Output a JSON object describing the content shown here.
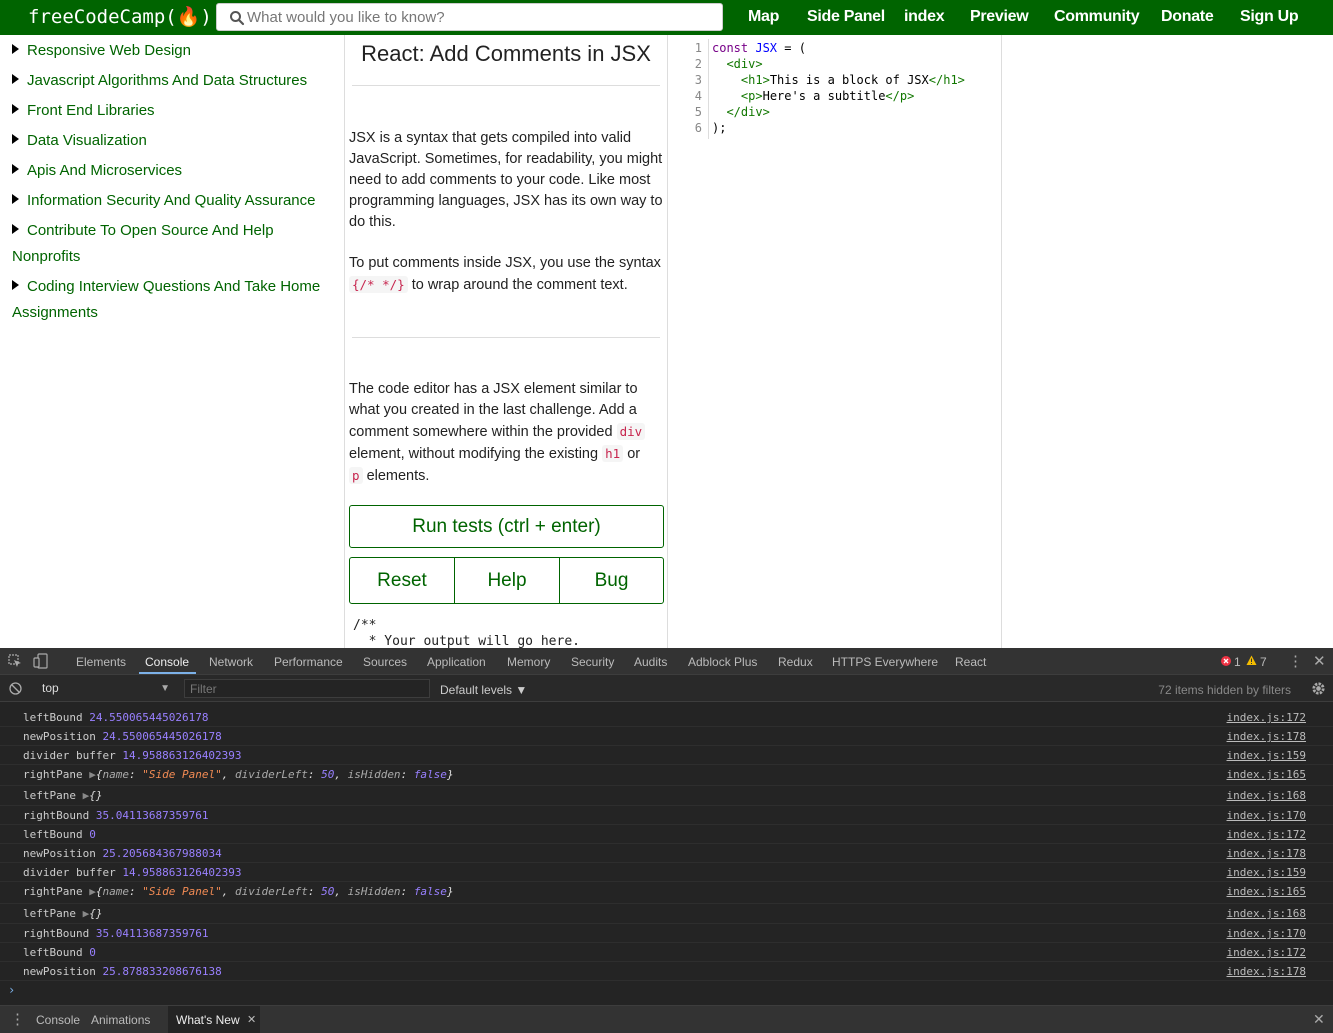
{
  "nav": {
    "logo": "freeCodeCamp(🔥)",
    "search_placeholder": "What would you like to know?",
    "links": [
      "Map",
      "Side Panel",
      "index",
      "Preview",
      "Community",
      "Donate",
      "Sign Up"
    ]
  },
  "map": {
    "items": [
      {
        "label": "Responsive Web Design"
      },
      {
        "label": "Javascript Algorithms And Data Structures"
      },
      {
        "label": "Front End Libraries"
      },
      {
        "label": "Data Visualization"
      },
      {
        "label": "Apis And Microservices"
      },
      {
        "label": "Information Security And Quality Assurance"
      },
      {
        "label": "Contribute To Open Source And Help Nonprofits"
      },
      {
        "label": "Coding Interview Questions And Take Home Assignments"
      }
    ]
  },
  "challenge": {
    "title": "React: Add Comments in JSX",
    "p1": "JSX is a syntax that gets compiled into valid JavaScript. Sometimes, for readability, you might need to add comments to your code. Like most programming languages, JSX has its own way to do this.",
    "p2_a": "To put comments inside JSX, you use the syntax",
    "p2_code": "{/* */}",
    "p2_b": "to wrap around the comment text.",
    "p3_a": "The code editor has a JSX element similar to what you created in the last challenge. Add a comment somewhere within the provided",
    "p3_code1": "div",
    "p3_b": "element, without modifying the existing",
    "p3_code2": "h1",
    "p3_c": "or",
    "p3_code3": "p",
    "p3_d": "elements.",
    "run_label": "Run tests (ctrl + enter)",
    "reset_label": "Reset",
    "help_label": "Help",
    "bug_label": "Bug",
    "output": "/**\n  * Your output will go here."
  },
  "editor": {
    "line_numbers": [
      "1",
      "2",
      "3",
      "4",
      "5",
      "6"
    ]
  },
  "devtools": {
    "tabs": [
      "Elements",
      "Console",
      "Network",
      "Performance",
      "Sources",
      "Application",
      "Memory",
      "Security",
      "Audits",
      "Adblock Plus",
      "Redux",
      "HTTPS Everywhere",
      "React"
    ],
    "errors": "1",
    "warnings": "7",
    "context": "top",
    "filter_placeholder": "Filter",
    "levels": "Default levels ▼",
    "hidden": "72 items hidden by filters",
    "logs": [
      {
        "label": "leftBound",
        "value": "24.550065445026178",
        "src": "index.js:172"
      },
      {
        "label": "newPosition",
        "value": "24.550065445026178",
        "src": "index.js:178"
      },
      {
        "label": "divider buffer",
        "value": "14.958863126402393",
        "src": "index.js:159"
      },
      {
        "label": "rightPane",
        "value": "",
        "src": "index.js:165"
      },
      {
        "label": "leftPane",
        "value": "",
        "src": "index.js:168"
      },
      {
        "label": "rightBound",
        "value": "35.04113687359761",
        "src": "index.js:170"
      },
      {
        "label": "leftBound",
        "value": "0",
        "src": "index.js:172"
      },
      {
        "label": "newPosition",
        "value": "25.205684367988034",
        "src": "index.js:178"
      },
      {
        "label": "divider buffer",
        "value": "14.958863126402393",
        "src": "index.js:159"
      },
      {
        "label": "rightPane",
        "value": "",
        "src": "index.js:165"
      },
      {
        "label": "leftPane",
        "value": "",
        "src": "index.js:168"
      },
      {
        "label": "rightBound",
        "value": "35.04113687359761",
        "src": "index.js:170"
      },
      {
        "label": "leftBound",
        "value": "0",
        "src": "index.js:172"
      },
      {
        "label": "newPosition",
        "value": "25.878833208676138",
        "src": "index.js:178"
      }
    ],
    "drawer_tabs": [
      "Console",
      "Animations",
      "What's New"
    ]
  }
}
